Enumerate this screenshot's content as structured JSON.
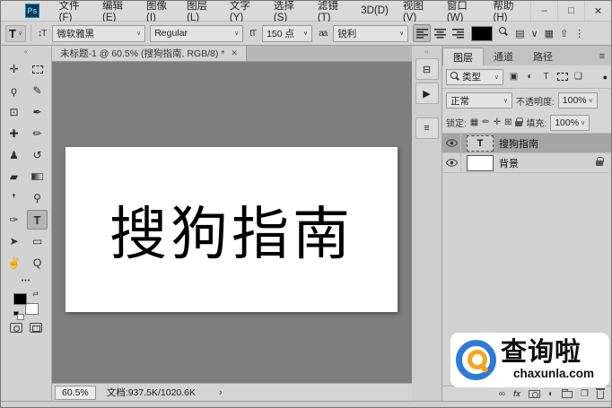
{
  "icons": {
    "chevron": "∨"
  },
  "window": {
    "logo": "Ps",
    "controls": [
      {
        "name": "minimize-button",
        "glyph": "–"
      },
      {
        "name": "maximize-button",
        "glyph": "□"
      },
      {
        "name": "close-button",
        "glyph": "✕"
      }
    ]
  },
  "menu": {
    "items": [
      "文件(F)",
      "编辑(E)",
      "图像(I)",
      "图层(L)",
      "文字(Y)",
      "选择(S)",
      "滤镜(T)",
      "3D(D)",
      "视图(V)",
      "窗口(W)",
      "帮助(H)"
    ]
  },
  "options": {
    "tool_glyph": "T",
    "orientation_glyph": "↕T",
    "font_family": "微软雅黑",
    "font_style": "Regular",
    "size_glyph": "tT",
    "font_size": "150 点",
    "aa_glyph": "aa",
    "anti_alias": "锐利",
    "text_color": "#000000",
    "right_icons": [
      {
        "name": "search-icon",
        "shape": "search"
      },
      {
        "name": "panel-toggle-icon",
        "glyph": "▤"
      },
      {
        "name": "chevron-down-icon",
        "glyph": "∨"
      },
      {
        "name": "workspace-icon",
        "glyph": "▦"
      },
      {
        "name": "share-icon",
        "glyph": "⇧"
      },
      {
        "name": "kebab-menu-icon",
        "glyph": "⋮"
      }
    ]
  },
  "document_tab": {
    "title": "未标题-1 @ 60.5% (搜狗指南, RGB/8) *",
    "close_glyph": "✕"
  },
  "canvas": {
    "text": "搜狗指南"
  },
  "toolbar": {
    "collapse_glyph": "«",
    "more_glyph": "•••",
    "foreground_color": "#000000",
    "background_color": "#ffffff",
    "tools": [
      {
        "name": "move-tool",
        "glyph": "✛"
      },
      {
        "name": "marquee-tool",
        "shape": "marquee"
      },
      {
        "name": "lasso-tool",
        "glyph": "ϙ"
      },
      {
        "name": "quick-selection-tool",
        "glyph": "✎"
      },
      {
        "name": "crop-tool",
        "glyph": "⊡"
      },
      {
        "name": "eyedropper-tool",
        "glyph": "✒"
      },
      {
        "name": "healing-brush-tool",
        "glyph": "✚"
      },
      {
        "name": "brush-tool",
        "glyph": "✏"
      },
      {
        "name": "clone-stamp-tool",
        "glyph": "♟"
      },
      {
        "name": "history-brush-tool",
        "glyph": "↺"
      },
      {
        "name": "eraser-tool",
        "glyph": "▰"
      },
      {
        "name": "gradient-tool",
        "shape": "gradient"
      },
      {
        "name": "blur-tool",
        "glyph": "❜"
      },
      {
        "name": "dodge-tool",
        "glyph": "⚲"
      },
      {
        "name": "pen-tool",
        "glyph": "✑"
      },
      {
        "name": "type-tool",
        "glyph": "T",
        "selected": true
      },
      {
        "name": "path-selection-tool",
        "glyph": "➤"
      },
      {
        "name": "rectangle-tool",
        "glyph": "▭"
      },
      {
        "name": "hand-tool",
        "glyph": "✌"
      },
      {
        "name": "zoom-tool",
        "glyph": "Q"
      }
    ]
  },
  "dock": {
    "collapse_glyph": "«",
    "panels": [
      {
        "name": "history-panel-button",
        "glyph": "⊟"
      },
      {
        "name": "actions-panel-button",
        "glyph": "▶"
      },
      {
        "name": "properties-panel-button",
        "glyph": "≡"
      }
    ]
  },
  "layers_panel": {
    "tabs": [
      {
        "label": "图层",
        "active": true
      },
      {
        "label": "通道",
        "active": false
      },
      {
        "label": "路径",
        "active": false
      }
    ],
    "panel_menu_glyph": "≡",
    "filter": {
      "label": "类型",
      "toggle_glyph": "●",
      "icons": [
        {
          "name": "filter-pixel-layers-icon",
          "glyph": "▣"
        },
        {
          "name": "filter-adjustment-layers-icon",
          "glyph": "◐"
        },
        {
          "name": "filter-type-layers-icon",
          "glyph": "T"
        },
        {
          "name": "filter-shape-layers-icon",
          "shape": "marquee"
        },
        {
          "name": "filter-smart-objects-icon",
          "glyph": "❏"
        }
      ]
    },
    "blend_mode": "正常",
    "opacity_label": "不透明度:",
    "opacity_value": "100%",
    "lock_label": "锁定:",
    "lock_icons": [
      {
        "name": "lock-transparency-icon",
        "glyph": "▦"
      },
      {
        "name": "lock-pixels-icon",
        "glyph": "✏"
      },
      {
        "name": "lock-position-icon",
        "glyph": "✛"
      },
      {
        "name": "lock-artboard-icon",
        "glyph": "⊞"
      },
      {
        "name": "lock-all-icon",
        "shape": "lock"
      }
    ],
    "fill_label": "填充:",
    "fill_value": "100%",
    "layers": [
      {
        "name": "搜狗指南",
        "thumb": "T",
        "type": "text",
        "selected": true,
        "visible": true,
        "locked": false
      },
      {
        "name": "背景",
        "thumb": "",
        "type": "background",
        "selected": false,
        "visible": true,
        "locked": true
      }
    ],
    "bottom_icons": [
      {
        "name": "link-layers-icon",
        "glyph": "∞"
      },
      {
        "name": "layer-effects-icon",
        "glyph": "fx"
      },
      {
        "name": "add-mask-icon",
        "shape": "mask"
      },
      {
        "name": "adjustment-layer-icon",
        "glyph": "◐"
      },
      {
        "name": "new-group-icon",
        "shape": "folder"
      },
      {
        "name": "new-layer-icon",
        "glyph": "❐"
      },
      {
        "name": "delete-layer-icon",
        "shape": "trash"
      }
    ]
  },
  "status_bar": {
    "zoom": "60.5%",
    "doc_info": "文档:937.5K/1020.6K",
    "chevron": "›"
  },
  "watermark": {
    "brand": "查询啦",
    "domain": "chaxunla.com"
  }
}
